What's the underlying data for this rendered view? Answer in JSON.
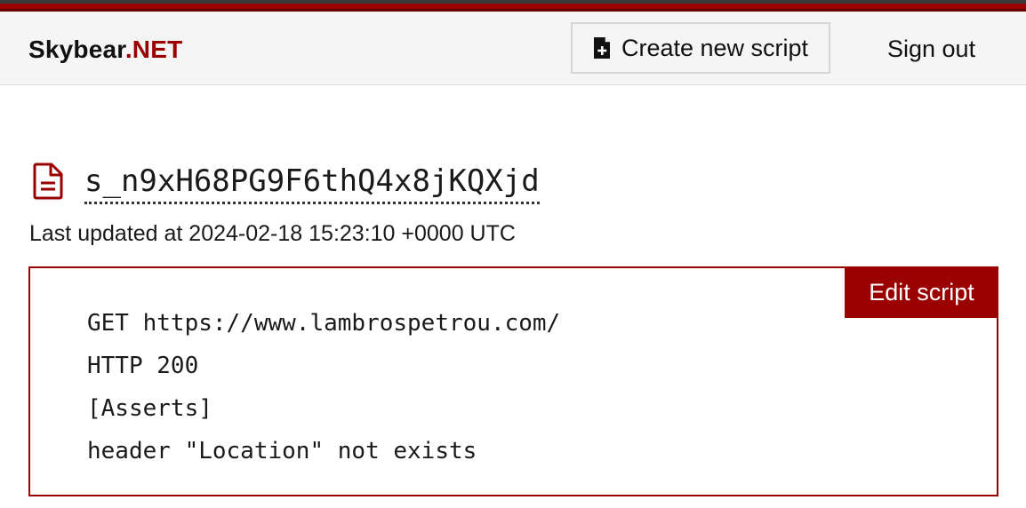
{
  "header": {
    "brand_main": "Skybear",
    "brand_suffix": ".NET",
    "create_label": "Create new script",
    "create_icon": "file-plus-icon",
    "signout_label": "Sign out"
  },
  "script": {
    "icon": "document-icon",
    "name": "s_n9xH68PG9F6thQ4x8jKQXjd",
    "updated": "Last updated at 2024-02-18 15:23:10 +0000 UTC",
    "edit_label": "Edit script",
    "lines": [
      "GET https://www.lambrospetrou.com/",
      "HTTP 200",
      "[Asserts]",
      "header \"Location\" not exists"
    ]
  },
  "colors": {
    "accent": "#9b0000",
    "header_bg": "#f5f5f5",
    "text": "#1a1a1a"
  }
}
